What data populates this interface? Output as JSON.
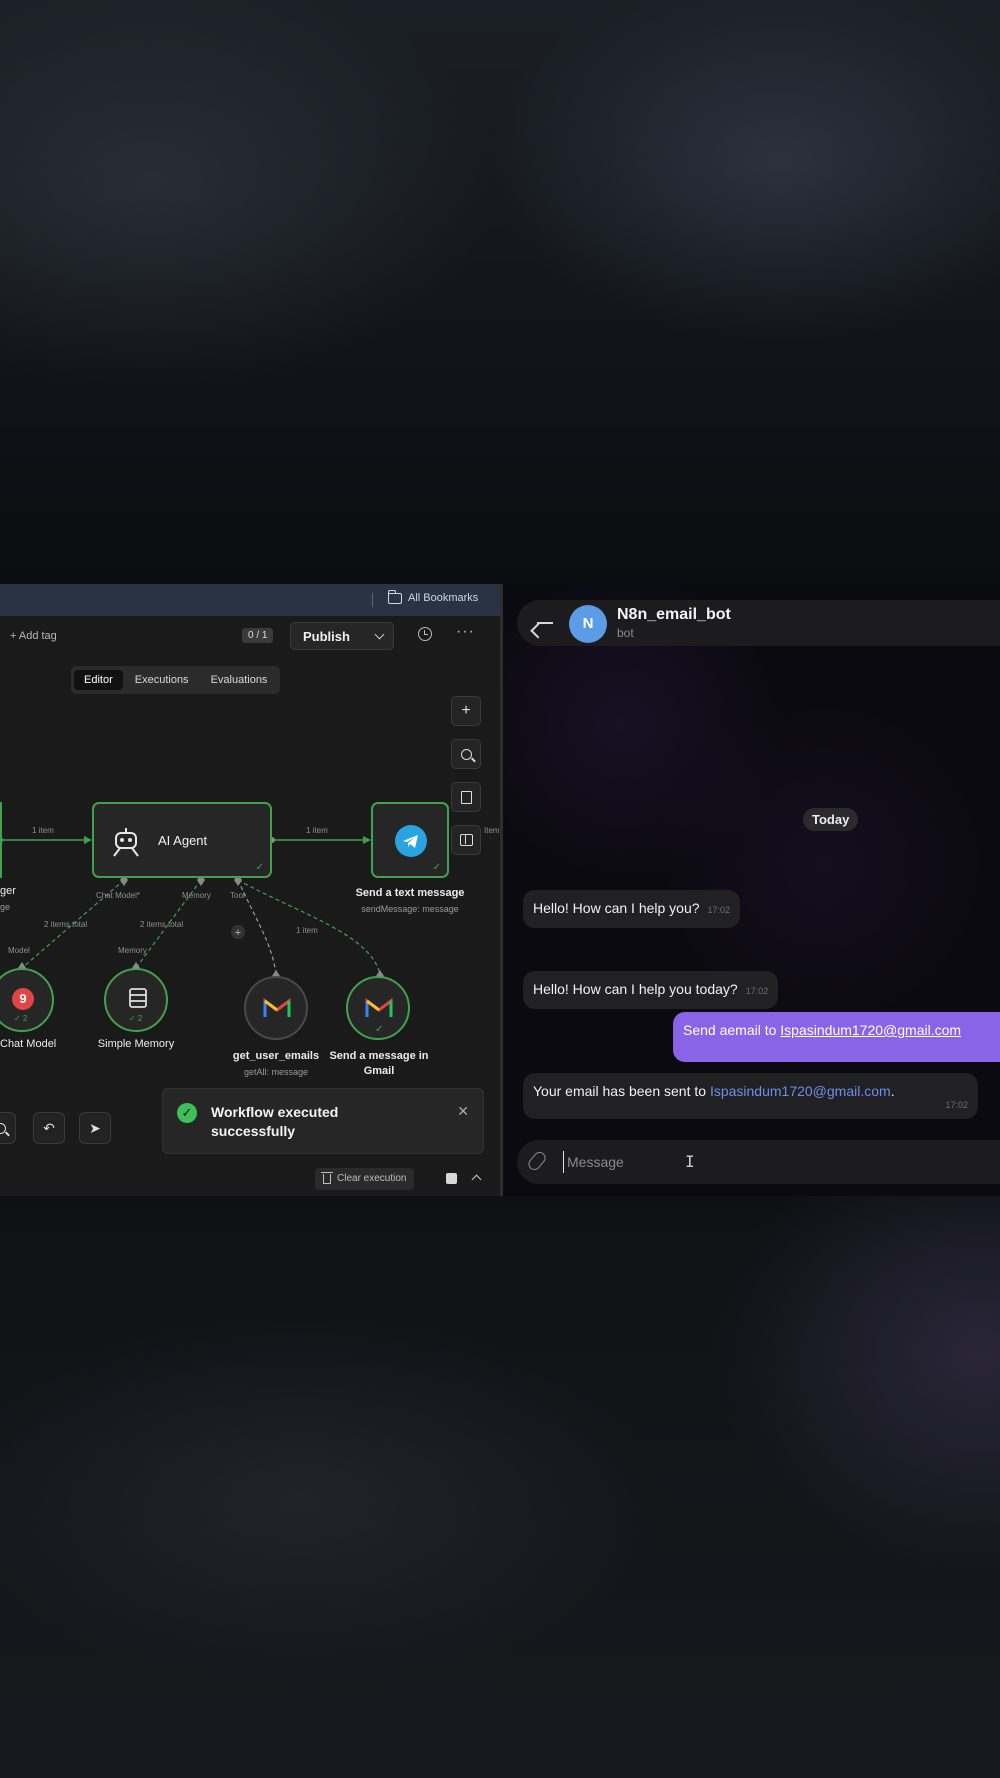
{
  "browser": {
    "bookmarks_label": "All Bookmarks"
  },
  "n8n": {
    "toolbar": {
      "add_tag": "+ Add tag",
      "counter": "0 / 1",
      "publish_label": "Publish"
    },
    "tabs": [
      {
        "label": "Editor",
        "active": true
      },
      {
        "label": "Executions",
        "active": false
      },
      {
        "label": "Evaluations",
        "active": false
      }
    ],
    "nodes": {
      "trigger_label_fragment": "ger",
      "trigger_sub_fragment": "ge",
      "agent_label": "AI Agent",
      "telegram_label": "Send a text message",
      "telegram_sub": "sendMessage: message",
      "chat_model_label": "Chat Model",
      "memory_label": "Simple Memory",
      "get_emails_label": "get_user_emails",
      "get_emails_sub": "getAll: message",
      "send_gmail_label": "Send a message in",
      "send_gmail_label2": "Gmail"
    },
    "connections": {
      "trigger_to_agent": "1 item",
      "agent_to_telegram": "1 item",
      "chat_model_port": "Chat Model*",
      "memory_port": "Memory",
      "tool_port": "Tool",
      "model_items": "2 items total",
      "memory_items": "2 items total",
      "tool_items": "1 item",
      "model_tag": "Model",
      "memory_tag": "Memory",
      "edge_item": "Item"
    },
    "badges": {
      "chat_model_count": "✓ 2",
      "memory_count": "✓ 2"
    },
    "toast": {
      "message": "Workflow executed successfully"
    },
    "footer": {
      "clear_execution": "Clear execution"
    }
  },
  "telegram": {
    "chat_name": "N8n_email_bot",
    "chat_sub": "bot",
    "avatar_letter": "N",
    "date_label": "Today",
    "messages": [
      {
        "direction": "in",
        "text": "Hello! How can I help you?",
        "time": "17:02"
      },
      {
        "direction": "in",
        "text": "Hello! How can I help you today?",
        "time": "17:02"
      },
      {
        "direction": "out",
        "text": "Send aemail to ",
        "link": "Ispasindum1720@gmail.com"
      },
      {
        "direction": "in",
        "text": "Your email has been sent to ",
        "link": "Ispasindum1720@gmail.com",
        "suffix": ".",
        "time": "17:02"
      }
    ],
    "composer_placeholder": "Message"
  },
  "colors": {
    "node_success": "#3fa34d",
    "telegram_blue": "#2aa4e0",
    "outgoing_bubble": "#8a64e6",
    "avatar": "#5c9ce6"
  }
}
